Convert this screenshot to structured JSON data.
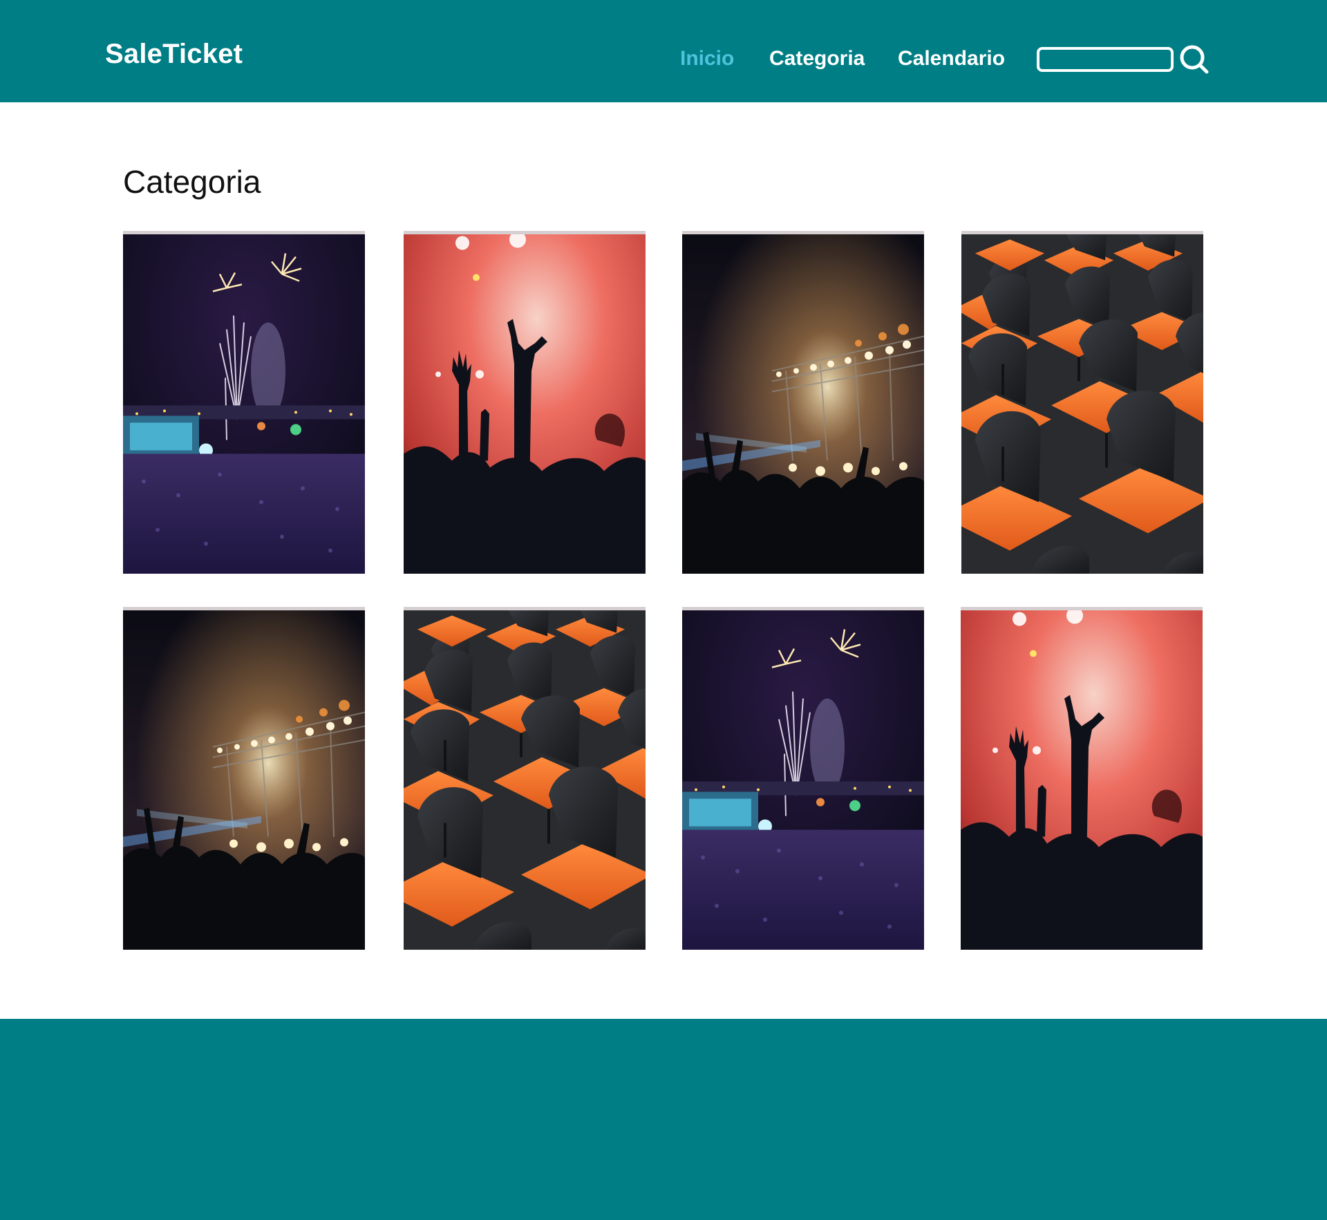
{
  "header": {
    "brand": "SaleTicket",
    "nav": [
      {
        "label": "Inicio",
        "active": true
      },
      {
        "label": "Categoria",
        "active": false
      },
      {
        "label": "Calendario",
        "active": false
      }
    ],
    "search": {
      "value": "",
      "placeholder": "",
      "icon": "search-icon"
    }
  },
  "main": {
    "title": "Categoria",
    "cards": [
      {
        "scene": "fireworks-festival"
      },
      {
        "scene": "red-concert-hands"
      },
      {
        "scene": "stage-lights-crowd"
      },
      {
        "scene": "orange-seats"
      },
      {
        "scene": "stage-lights-crowd"
      },
      {
        "scene": "orange-seats"
      },
      {
        "scene": "fireworks-festival"
      },
      {
        "scene": "red-concert-hands"
      }
    ]
  },
  "colors": {
    "brand": "#007e85",
    "nav_active": "#4fc3dc",
    "nav_text": "#ffffff"
  }
}
